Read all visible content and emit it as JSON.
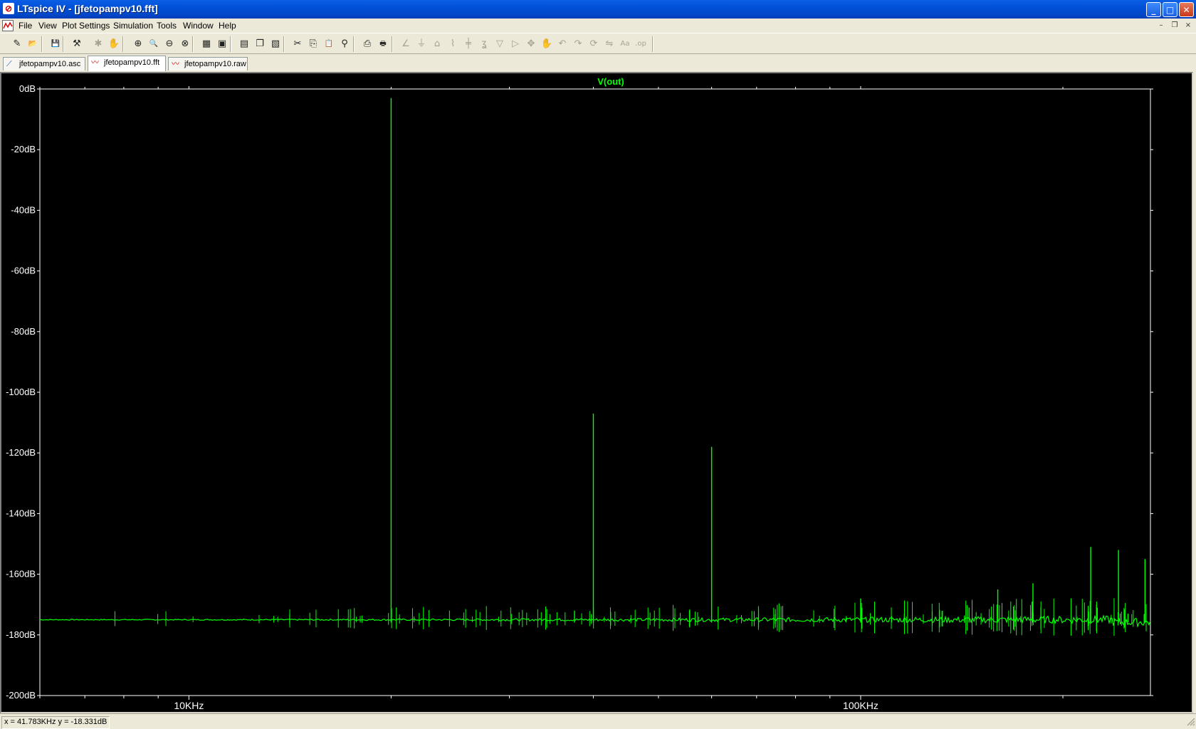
{
  "window": {
    "title": "LTspice IV - [jfetopampv10.fft]",
    "app_icon": "ltspice-icon",
    "buttons": {
      "minimize": "_",
      "maximize": "□",
      "close": "✕"
    },
    "mdi_buttons": {
      "minimize": "–",
      "restore": "❐",
      "close": "×"
    }
  },
  "menu": [
    "File",
    "View",
    "Plot Settings",
    "Simulation",
    "Tools",
    "Window",
    "Help"
  ],
  "toolbar": [
    {
      "icon": "new-schematic-icon",
      "glyph": "✎"
    },
    {
      "icon": "open-icon",
      "glyph": "📂"
    },
    {
      "icon": "save-icon",
      "glyph": "💾"
    },
    {
      "icon": "control-panel-icon",
      "glyph": "⚒"
    },
    {
      "icon": "run-icon",
      "glyph": "✱"
    },
    {
      "icon": "halt-icon",
      "glyph": "✋"
    },
    {
      "icon": "zoom-in-icon",
      "glyph": "⊕"
    },
    {
      "icon": "pan-icon",
      "glyph": "🔍"
    },
    {
      "icon": "zoom-out-icon",
      "glyph": "⊖"
    },
    {
      "icon": "zoom-full-icon",
      "glyph": "⊗"
    },
    {
      "icon": "autorange-icon",
      "glyph": "▦"
    },
    {
      "icon": "fit-icon",
      "glyph": "▣"
    },
    {
      "icon": "tile-horizontal-icon",
      "glyph": "▤"
    },
    {
      "icon": "cascade-icon",
      "glyph": "❐"
    },
    {
      "icon": "close-windows-icon",
      "glyph": "▧"
    },
    {
      "icon": "cut-icon",
      "glyph": "✂"
    },
    {
      "icon": "copy-icon",
      "glyph": "⎘"
    },
    {
      "icon": "paste-icon",
      "glyph": "📋"
    },
    {
      "icon": "find-icon",
      "glyph": "⚲"
    },
    {
      "icon": "print-preview-icon",
      "glyph": "⎙"
    },
    {
      "icon": "print-icon",
      "glyph": "🖶"
    },
    {
      "icon": "wire-icon",
      "glyph": "∠"
    },
    {
      "icon": "ground-icon",
      "glyph": "⏚"
    },
    {
      "icon": "label-net-icon",
      "glyph": "⌂"
    },
    {
      "icon": "resistor-icon",
      "glyph": "⌇"
    },
    {
      "icon": "capacitor-icon",
      "glyph": "╪"
    },
    {
      "icon": "inductor-icon",
      "glyph": "ʓ"
    },
    {
      "icon": "diode-icon",
      "glyph": "▽"
    },
    {
      "icon": "component-icon",
      "glyph": "▷"
    },
    {
      "icon": "move-icon",
      "glyph": "✥"
    },
    {
      "icon": "drag-icon",
      "glyph": "✋"
    },
    {
      "icon": "undo-icon",
      "glyph": "↶"
    },
    {
      "icon": "redo-icon",
      "glyph": "↷"
    },
    {
      "icon": "rotate-icon",
      "glyph": "⟳"
    },
    {
      "icon": "mirror-icon",
      "glyph": "⇋"
    },
    {
      "icon": "text-icon",
      "glyph": "Aa"
    },
    {
      "icon": "spice-directive-icon",
      "glyph": ".op"
    }
  ],
  "tabs": [
    {
      "label": "jfetopampv10.asc",
      "icon": "schematic-icon",
      "active": false
    },
    {
      "label": "jfetopampv10.fft",
      "icon": "waveform-icon",
      "active": true
    },
    {
      "label": "jfetopampv10.raw",
      "icon": "waveform-icon",
      "active": false
    }
  ],
  "plot": {
    "trace_label": "V(out)",
    "trace_color": "#00ff00",
    "axis_color": "#ffffff",
    "grid_color": "#6e6e6e",
    "background": "#000000"
  },
  "chart_data": {
    "type": "line",
    "title": "",
    "series": [
      {
        "name": "V(out)"
      }
    ],
    "xscale": "log",
    "xlim_hz": [
      6000,
      270000
    ],
    "ylim": [
      -200,
      0
    ],
    "y_ticks": [
      "0dB",
      "-20dB",
      "-40dB",
      "-60dB",
      "-80dB",
      "-100dB",
      "-120dB",
      "-140dB",
      "-160dB",
      "-180dB",
      "-200dB"
    ],
    "x_ticks": [
      {
        "value": 10000,
        "label": "10KHz"
      },
      {
        "value": 100000,
        "label": "100KHz"
      }
    ],
    "noise_floor_db": -175,
    "peaks": [
      {
        "f_hz": 20000,
        "db": -3
      },
      {
        "f_hz": 40000,
        "db": -107
      },
      {
        "f_hz": 60000,
        "db": -118
      },
      {
        "f_hz": 37500,
        "db": -172
      },
      {
        "f_hz": 100000,
        "db": -168
      },
      {
        "f_hz": 145000,
        "db": -171
      },
      {
        "f_hz": 160000,
        "db": -165
      },
      {
        "f_hz": 180000,
        "db": -169
      },
      {
        "f_hz": 180500,
        "db": -163
      },
      {
        "f_hz": 220000,
        "db": -151
      },
      {
        "f_hz": 225000,
        "db": -171
      },
      {
        "f_hz": 242000,
        "db": -152
      },
      {
        "f_hz": 250000,
        "db": -173
      },
      {
        "f_hz": 265000,
        "db": -155
      }
    ]
  },
  "status": {
    "readout": "x = 41.783KHz     y = -18.331dB"
  }
}
